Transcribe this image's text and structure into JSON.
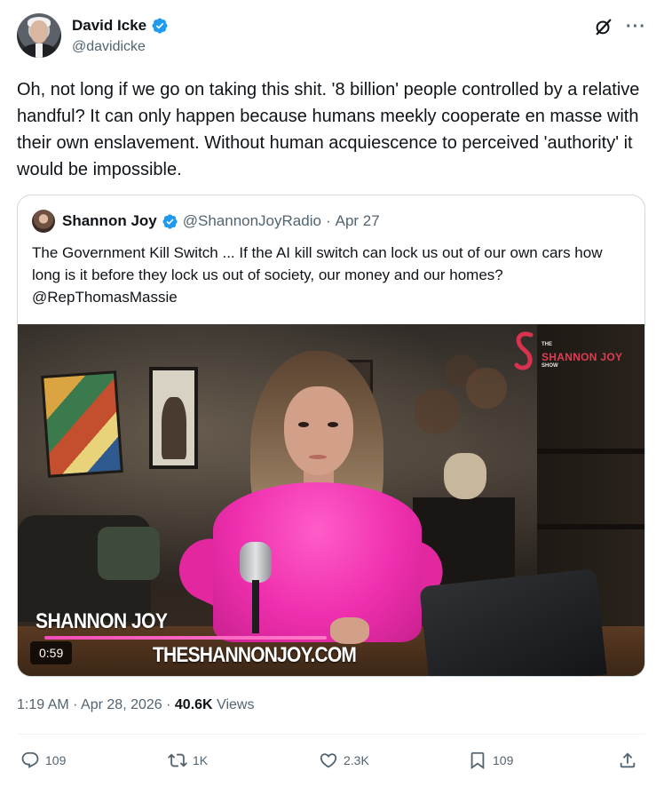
{
  "author": {
    "display_name": "David Icke",
    "handle": "@davidicke",
    "verified": true
  },
  "tweet": {
    "text": "Oh, not long if we go on taking this shit. '8 billion' people controlled by a relative handful? It can only happen because humans meekly cooperate en masse with their own enslavement. Without human acquiescence to perceived 'authority' it would be impossible."
  },
  "quoted": {
    "display_name": "Shannon Joy",
    "handle": "@ShannonJoyRadio",
    "separator": "·",
    "date": "Apr 27",
    "verified": true,
    "text": "The Government Kill Switch ...  If the AI kill switch can lock us out of our own cars how long is it before they lock us out of society, our money and our homes? @RepThomasMassie",
    "video": {
      "duration": "0:59",
      "name_banner": "SHANNON JOY",
      "site_banner": "THESHANNONJOY.COM",
      "logo_top": "THE",
      "logo_main": "SHANNON JOY",
      "logo_bottom": "SHOW"
    }
  },
  "meta": {
    "time": "1:19 AM",
    "sep1": "·",
    "date": "Apr 28, 2026",
    "sep2": "·",
    "views_count": "40.6K",
    "views_label": "Views"
  },
  "actions": {
    "replies": "109",
    "reposts": "1K",
    "likes": "2.3K",
    "bookmarks": "109"
  },
  "colors": {
    "verified": "#1d9bf0",
    "text": "#0f1419",
    "secondary": "#536471",
    "border": "#cfd9de"
  },
  "icons": [
    "verified-badge-icon",
    "grok-icon",
    "more-icon",
    "reply-icon",
    "repost-icon",
    "like-icon",
    "bookmark-icon",
    "share-icon"
  ]
}
